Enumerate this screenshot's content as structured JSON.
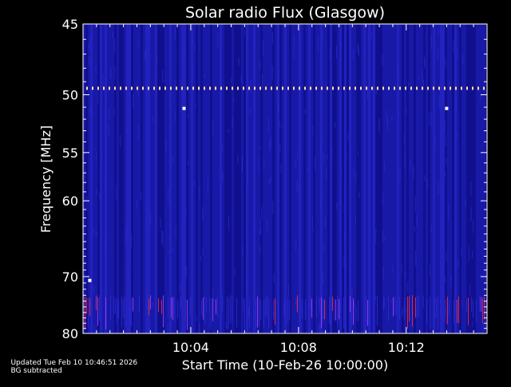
{
  "chart_data": {
    "type": "heatmap",
    "title": "Solar radio Flux (Glasgow)",
    "ylabel": "Frequency [MHz]",
    "xlabel": "Start Time (10-Feb-26 10:00:00)",
    "y_ticks": [
      45,
      50,
      55,
      60,
      70,
      80
    ],
    "y_tick_labels": [
      "45",
      "50",
      "55",
      "60",
      "70",
      "80"
    ],
    "x_ticks": [
      4,
      8,
      12
    ],
    "x_tick_labels": [
      "10:04",
      "10:08",
      "10:12"
    ],
    "x_range_min": [
      0,
      15
    ],
    "y_range_mhz": [
      45,
      80
    ],
    "colormap": {
      "background": "#1a1aa8",
      "low": "#0a0a7a",
      "mid": "#2a2ad0",
      "high": "#ff3030",
      "peak": "#ffffff"
    },
    "features": {
      "dotted_line_mhz": 49.5,
      "dense_band_mhz": [
        73,
        79
      ]
    },
    "grid": false
  },
  "footer": {
    "updated": "Updated Tue Feb 10 10:46:51 2026",
    "note": "BG subtracted"
  }
}
